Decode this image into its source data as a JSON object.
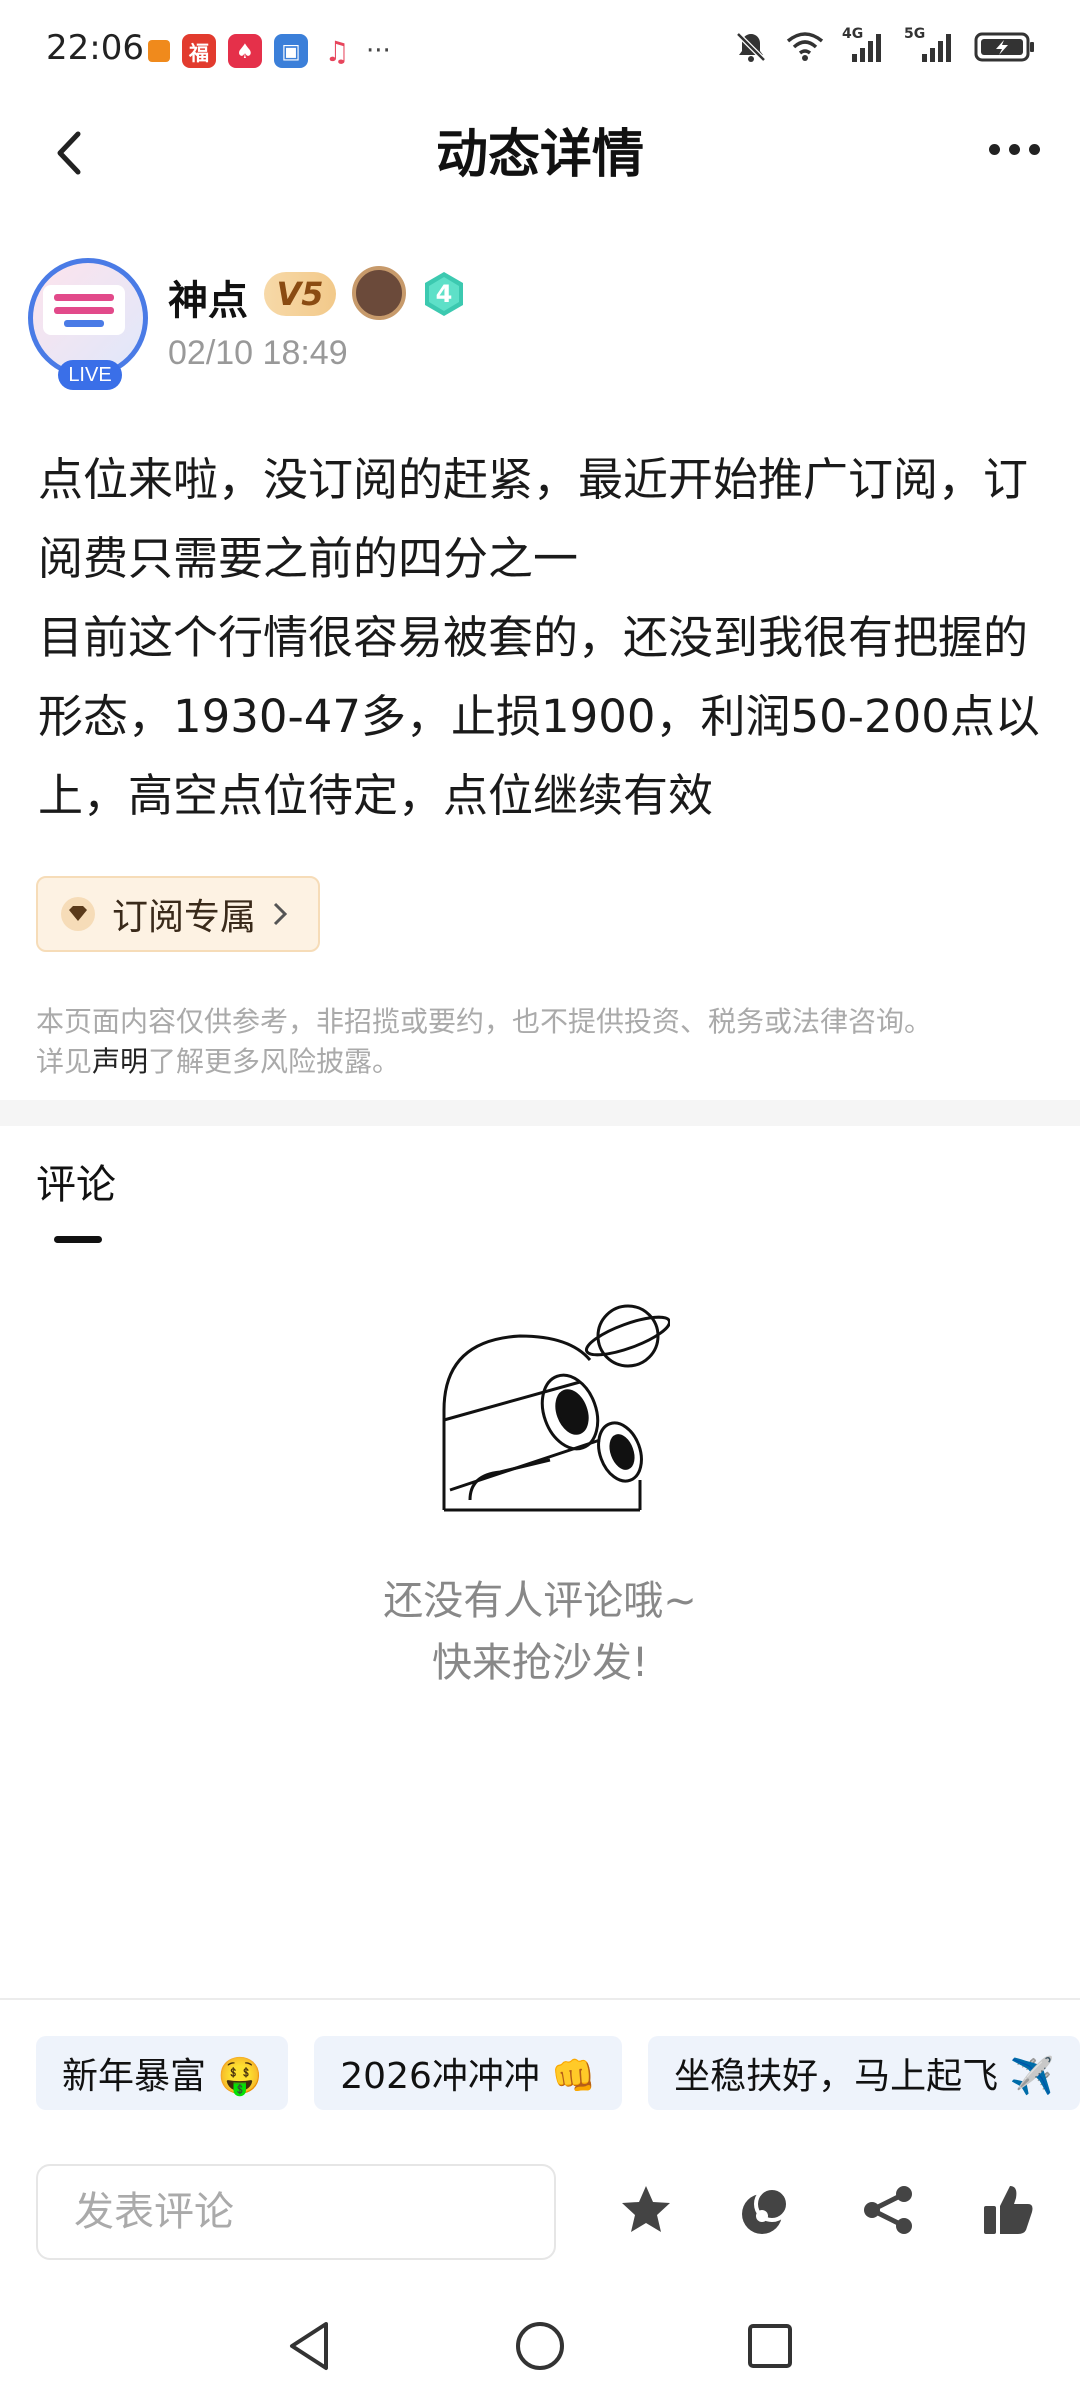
{
  "status_bar": {
    "time": "22:06",
    "more_indicator": "···",
    "network_4g": "4G",
    "network_5g": "5G"
  },
  "nav": {
    "title": "动态详情",
    "back_icon": "chevron-left-icon",
    "more_icon": "more-horizontal-icon"
  },
  "author": {
    "avatar_live_label": "LIVE",
    "name": "神点",
    "vip_label": "V5",
    "level": "4",
    "post_time": "02/10 18:49"
  },
  "post": {
    "text": "点位来啦，没订阅的赶紧，最近开始推广订阅，订阅费只需要之前的四分之一\n目前这个行情很容易被套的，还没到我很有把握的形态，1930-47多，止损1900，利润50-200点以上，高空点位待定，点位继续有效"
  },
  "subscription_tag": {
    "label": "订阅专属"
  },
  "disclaimer": {
    "line1": "本页面内容仅供参考，非招揽或要约，也不提供投资、税务或法律咨询。",
    "prefix": "详见",
    "link": "声明",
    "suffix": "了解更多风险披露。"
  },
  "comments": {
    "title": "评论",
    "empty_line1": "还没有人评论哦~",
    "empty_line2": "快来抢沙发!"
  },
  "quick_replies": [
    {
      "label": "新年暴富 🤑"
    },
    {
      "label": "2026冲冲冲 👊"
    },
    {
      "label": "坐稳扶好，马上起飞 ✈️"
    }
  ],
  "bottom_bar": {
    "comment_placeholder": "发表评论",
    "icons": [
      "star-icon",
      "coin-icon",
      "share-icon",
      "thumbs-up-icon"
    ]
  },
  "colors": {
    "accent_blue": "#3a6fe8",
    "vip_gold": "#f2c98a",
    "level_teal": "#3cc9b0",
    "chip_bg": "#eef3fb"
  }
}
